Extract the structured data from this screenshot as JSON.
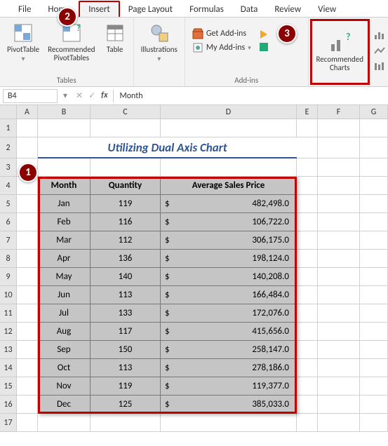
{
  "tabs": [
    "File",
    "Home",
    "Insert",
    "Page Layout",
    "Formulas",
    "Data",
    "Review",
    "View"
  ],
  "active_tab": "Insert",
  "ribbon": {
    "tables": {
      "pivot": "PivotTable",
      "rec_pivot": "Recommended\nPivotTables",
      "table": "Table",
      "group": "Tables"
    },
    "illus": {
      "label": "Illustrations"
    },
    "addins": {
      "get": "Get Add-ins",
      "my": "My Add-ins",
      "group": "Add-ins"
    },
    "charts": {
      "rec": "Recommended\nCharts"
    }
  },
  "namebox": "B4",
  "formula": "Month",
  "columns": [
    "A",
    "B",
    "C",
    "D",
    "E",
    "F",
    "G"
  ],
  "row_numbers": [
    1,
    2,
    3,
    4,
    5,
    6,
    7,
    8,
    9,
    10,
    11,
    12,
    13,
    14,
    15,
    16,
    17
  ],
  "title": "Utilizing Dual Axis Chart",
  "headers": {
    "month": "Month",
    "qty": "Quantity",
    "price": "Average Sales Price"
  },
  "rows": [
    {
      "m": "Jan",
      "q": "119",
      "p": "482,498.0"
    },
    {
      "m": "Feb",
      "q": "116",
      "p": "106,722.0"
    },
    {
      "m": "Mar",
      "q": "112",
      "p": "306,175.0"
    },
    {
      "m": "Apr",
      "q": "136",
      "p": "198,124.0"
    },
    {
      "m": "May",
      "q": "140",
      "p": "140,208.0"
    },
    {
      "m": "Jun",
      "q": "113",
      "p": "166,484.0"
    },
    {
      "m": "Jul",
      "q": "133",
      "p": "172,076.0"
    },
    {
      "m": "Aug",
      "q": "117",
      "p": "415,656.0"
    },
    {
      "m": "Sep",
      "q": "150",
      "p": "258,147.0"
    },
    {
      "m": "Oct",
      "q": "113",
      "p": "278,186.0"
    },
    {
      "m": "Nov",
      "q": "119",
      "p": "119,377.0"
    },
    {
      "m": "Dec",
      "q": "125",
      "p": "385,033.0"
    }
  ],
  "badges": {
    "b1": "1",
    "b2": "2",
    "b3": "3"
  },
  "currency": "$"
}
